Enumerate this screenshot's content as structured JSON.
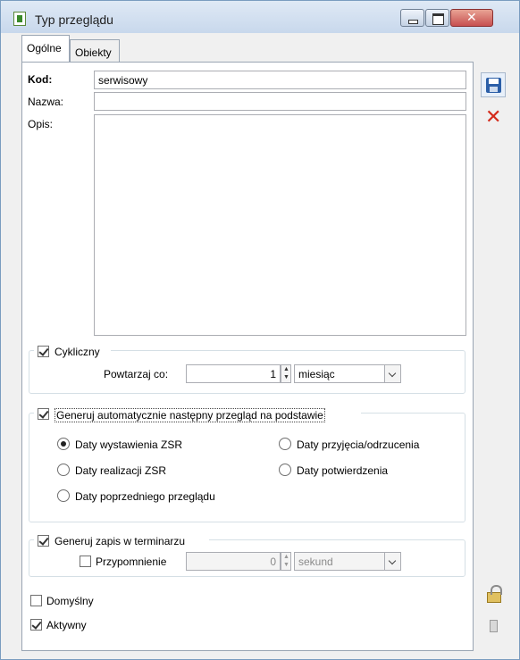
{
  "window": {
    "title": "Typ przeglądu"
  },
  "tabs": [
    {
      "label": "Ogólne",
      "active": true
    },
    {
      "label": "Obiekty",
      "active": false
    }
  ],
  "form": {
    "kod_label": "Kod:",
    "kod_value": "serwisowy",
    "nazwa_label": "Nazwa:",
    "nazwa_value": "",
    "opis_label": "Opis:",
    "opis_value": ""
  },
  "cykliczny": {
    "label": "Cykliczny",
    "checked": true,
    "repeat_label": "Powtarzaj co:",
    "repeat_value": "1",
    "unit_value": "miesiąc"
  },
  "generuj": {
    "label": "Generuj automatycznie następny przegląd na podstawie",
    "checked": true,
    "options": [
      {
        "label": "Daty wystawienia ZSR",
        "selected": true
      },
      {
        "label": "Daty przyjęcia/odrzucenia",
        "selected": false
      },
      {
        "label": "Daty realizacji ZSR",
        "selected": false
      },
      {
        "label": "Daty potwierdzenia",
        "selected": false
      },
      {
        "label": "Daty poprzedniego przeglądu",
        "selected": false
      }
    ]
  },
  "terminarz": {
    "label": "Generuj zapis w terminarzu",
    "checked": true,
    "reminder_label": "Przypomnienie",
    "reminder_checked": false,
    "reminder_value": "0",
    "reminder_unit": "sekund"
  },
  "flags": {
    "domyslny_label": "Domyślny",
    "domyslny_checked": false,
    "aktywny_label": "Aktywny",
    "aktywny_checked": true
  },
  "icons": {
    "app": "app-icon",
    "save": "save-icon",
    "delete": "delete-icon",
    "lock": "lock-icon",
    "pin": "pin-icon"
  }
}
